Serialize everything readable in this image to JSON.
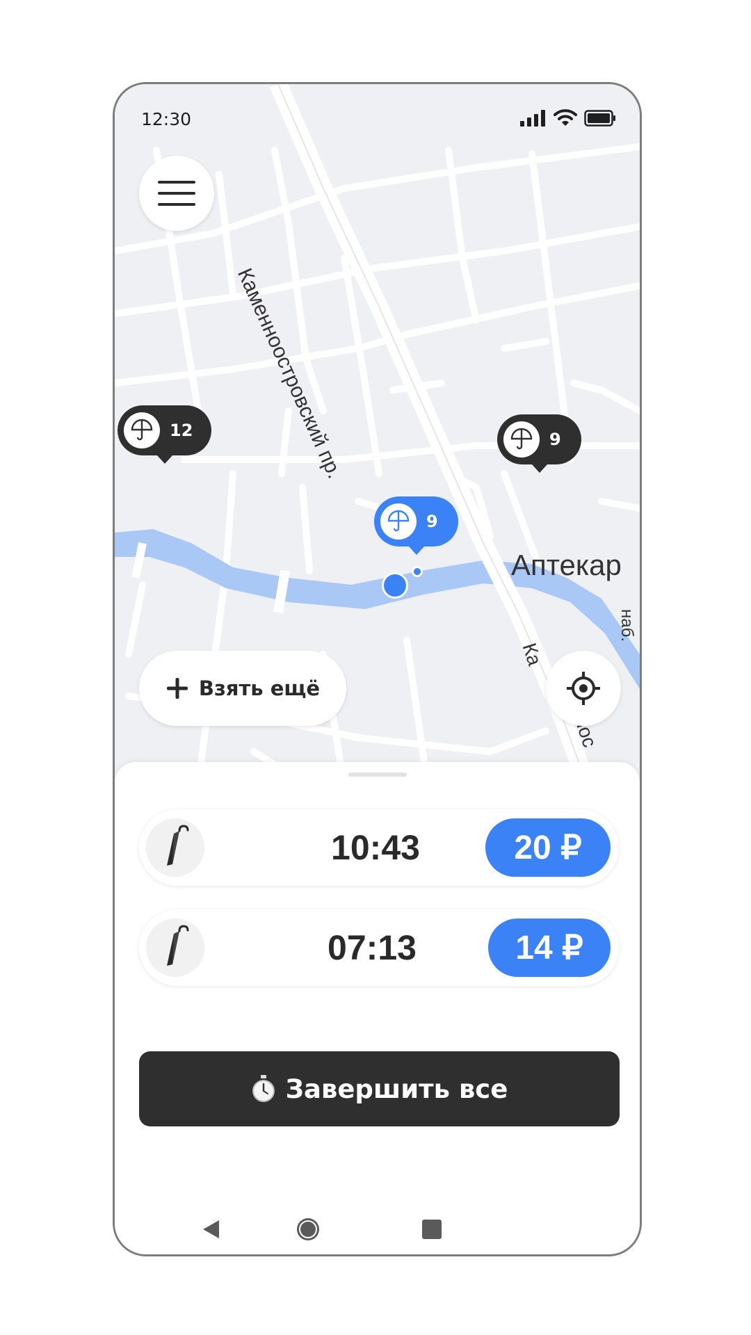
{
  "status_bar": {
    "time": "12:30",
    "icons": [
      "signal-icon",
      "wifi-icon",
      "battery-icon"
    ]
  },
  "map": {
    "street_labels": [
      "Каменноостровский пр.",
      "Аптекар",
      "Ка",
      "нос",
      "наб."
    ],
    "pins": [
      {
        "count": "12",
        "style": "dark",
        "icon": "umbrella-icon"
      },
      {
        "count": "9",
        "style": "dark",
        "icon": "umbrella-icon"
      },
      {
        "count": "9",
        "style": "blue",
        "icon": "umbrella-icon"
      }
    ],
    "colors": {
      "water": "#a9c8f5",
      "land": "#eef0f3",
      "road": "#ffffff"
    }
  },
  "menu_button": {
    "icon": "hamburger-icon"
  },
  "take_more_button": {
    "label": "Взять ещё",
    "icon": "plus-icon"
  },
  "locate_button": {
    "icon": "locate-icon"
  },
  "rentals": [
    {
      "timer": "10:43",
      "price": "20 ₽",
      "icon": "umbrella-closed-icon"
    },
    {
      "timer": "07:13",
      "price": "14 ₽",
      "icon": "umbrella-closed-icon"
    }
  ],
  "finish_button": {
    "label": "Завершить все",
    "icon": "stopwatch-icon"
  },
  "nav": {
    "buttons": [
      "back-icon",
      "home-icon",
      "recents-icon"
    ]
  },
  "colors": {
    "accent": "#3b82f6",
    "dark": "#2f2f2f",
    "text": "#2a2a2a"
  }
}
